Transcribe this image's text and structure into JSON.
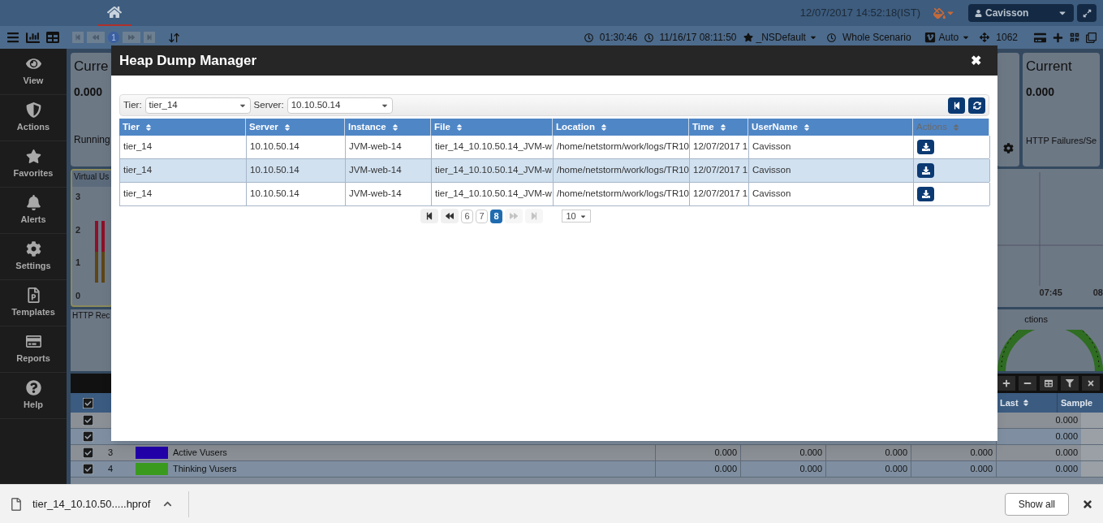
{
  "header": {
    "date_time": "12/07/2017 14:52:18(IST)",
    "user": "Cavisson"
  },
  "toolbar": {
    "page": "1",
    "elapsed": "01:30:46",
    "start": "11/16/17 08:11:50",
    "favorite": "_NSDefault",
    "scenario": "Whole Scenario",
    "mode": "Auto",
    "count": "1062"
  },
  "sidebar": {
    "items": [
      {
        "label": "View",
        "kind": "eye"
      },
      {
        "label": "Actions",
        "kind": "shield"
      },
      {
        "label": "Favorites",
        "kind": "star"
      },
      {
        "label": "Alerts",
        "kind": "bell"
      },
      {
        "label": "Settings",
        "kind": "gear"
      },
      {
        "label": "Templates",
        "kind": "template"
      },
      {
        "label": "Reports",
        "kind": "card"
      },
      {
        "label": "Help",
        "kind": "help"
      }
    ]
  },
  "dashboard": {
    "left_card": {
      "title": "Curre",
      "value": "0.000",
      "caption": "Running"
    },
    "right_card": {
      "title": "Current",
      "value": "0.000",
      "caption": "HTTP Failures/Se"
    },
    "vusers_panel": {
      "title": "Virtual Us",
      "yticks": [
        "3",
        "2",
        "1",
        "0"
      ]
    },
    "http_panel": {
      "title": "HTTP Rec"
    },
    "time_panel": {
      "xlabels": [
        "07:45",
        "08"
      ]
    },
    "gauge_panel": {
      "title": "ctions"
    },
    "grid": {
      "columns": [
        "Last",
        "Sample"
      ],
      "all_checked": true,
      "rows": [
        {
          "checked": true,
          "values": [
            "0.000"
          ]
        },
        {
          "checked": true,
          "values": [
            "0.000"
          ]
        },
        {
          "checked": true,
          "number": "3",
          "color": "#2200aa",
          "name": "Active Vusers",
          "values": [
            "0.000",
            "0.000",
            "0.000",
            "0.000",
            "0.000"
          ]
        },
        {
          "checked": true,
          "number": "4",
          "color": "#3a9a1e",
          "name": "Thinking Vusers",
          "values": [
            "0.000",
            "0.000",
            "0.000",
            "0.000",
            "0.000"
          ]
        }
      ]
    }
  },
  "dialog": {
    "title": "Heap Dump Manager",
    "close": "✖",
    "filters": [
      {
        "label": "Tier:",
        "value": "tier_14"
      },
      {
        "label": "Server:",
        "value": "10.10.50.14"
      }
    ],
    "columns": [
      {
        "label": "Tier",
        "disabled": false
      },
      {
        "label": "Server",
        "disabled": false
      },
      {
        "label": "Instance",
        "disabled": false
      },
      {
        "label": "File",
        "disabled": false
      },
      {
        "label": "Location",
        "disabled": false
      },
      {
        "label": "Time",
        "disabled": false
      },
      {
        "label": "UserName",
        "disabled": false
      },
      {
        "label": "Actions",
        "disabled": true
      }
    ],
    "rows": [
      {
        "selected": false,
        "cells": [
          "tier_14",
          "10.10.50.14",
          "JVM-web-14",
          "tier_14_10.10.50.14_JVM-w",
          "/home/netstorm/work/logs/TR10",
          "12/07/2017 1",
          "Cavisson"
        ]
      },
      {
        "selected": true,
        "cells": [
          "tier_14",
          "10.10.50.14",
          "JVM-web-14",
          "tier_14_10.10.50.14_JVM-w",
          "/home/netstorm/work/logs/TR10",
          "12/07/2017 1",
          "Cavisson"
        ]
      },
      {
        "selected": false,
        "cells": [
          "tier_14",
          "10.10.50.14",
          "JVM-web-14",
          "tier_14_10.10.50.14_JVM-w",
          "/home/netstorm/work/logs/TR10",
          "12/07/2017 1",
          "Cavisson"
        ]
      }
    ],
    "pager": {
      "nav": [
        {
          "kind": "first",
          "disabled": false
        },
        {
          "kind": "prev",
          "disabled": false
        },
        {
          "kind": "next",
          "disabled": true
        },
        {
          "kind": "last",
          "disabled": true
        }
      ],
      "pages": [
        {
          "label": "6",
          "selected": false
        },
        {
          "label": "7",
          "selected": false
        },
        {
          "label": "8",
          "selected": true
        }
      ],
      "page_size": "10"
    }
  },
  "download_bar": {
    "file": "tier_14_10.10.50.....hprof",
    "button": "Show all"
  }
}
